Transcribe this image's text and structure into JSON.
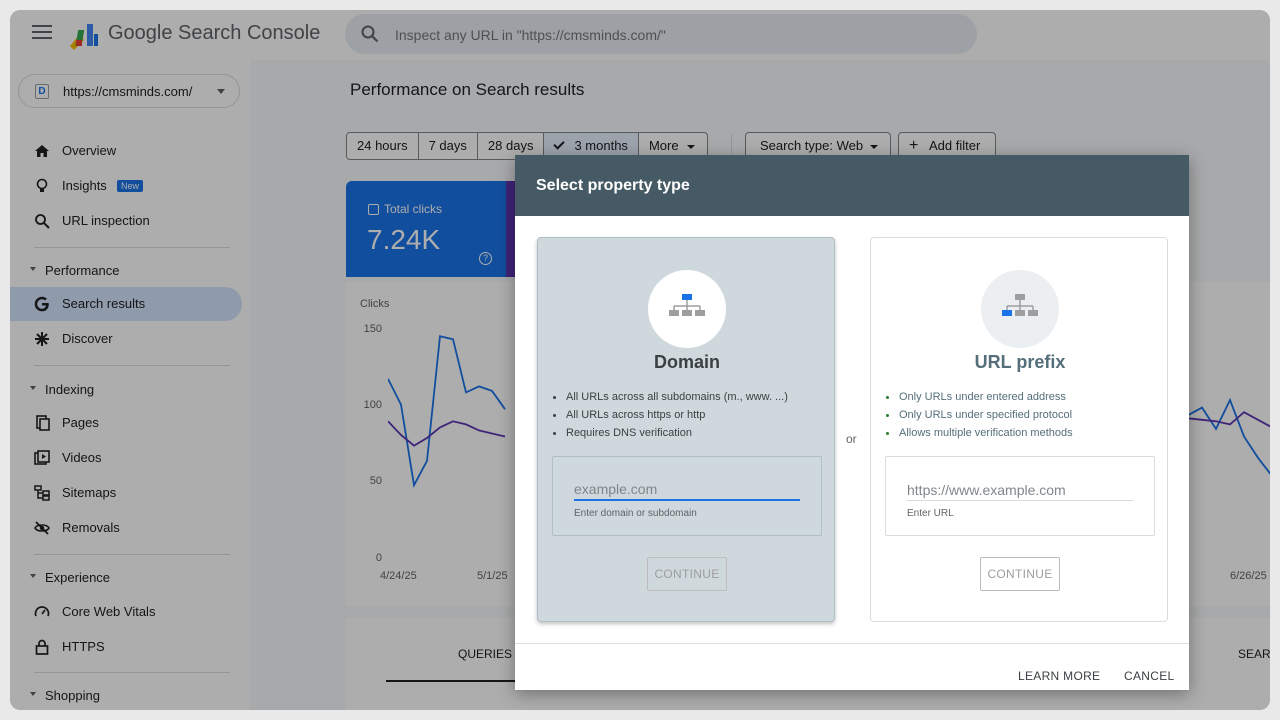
{
  "app": {
    "brand": "Google Search Console",
    "search_placeholder": "Inspect any URL in \"https://cmsminds.com/\""
  },
  "sidebar": {
    "property": {
      "badge": "D",
      "label": "https://cmsminds.com/"
    },
    "top_items": [
      {
        "label": "Overview",
        "icon": "home-icon"
      },
      {
        "label": "Insights",
        "icon": "lightbulb-icon",
        "badge": "New"
      },
      {
        "label": "URL inspection",
        "icon": "search-icon"
      }
    ],
    "sections": [
      {
        "label": "Performance",
        "items": [
          {
            "label": "Search results",
            "icon": "google-g-icon",
            "active": true
          },
          {
            "label": "Discover",
            "icon": "asterisk-icon"
          }
        ]
      },
      {
        "label": "Indexing",
        "items": [
          {
            "label": "Pages",
            "icon": "pages-icon"
          },
          {
            "label": "Videos",
            "icon": "videos-icon"
          },
          {
            "label": "Sitemaps",
            "icon": "sitemaps-icon"
          },
          {
            "label": "Removals",
            "icon": "eye-off-icon"
          }
        ]
      },
      {
        "label": "Experience",
        "items": [
          {
            "label": "Core Web Vitals",
            "icon": "gauge-icon"
          },
          {
            "label": "HTTPS",
            "icon": "lock-icon"
          }
        ]
      },
      {
        "label": "Shopping",
        "items": []
      }
    ]
  },
  "main": {
    "title": "Performance on Search results",
    "date_chips": [
      "24 hours",
      "7 days",
      "28 days",
      "3 months",
      "More"
    ],
    "selected_chip": "3 months",
    "search_type": "Search type: Web",
    "add_filter": "Add filter",
    "metric": {
      "label": "Total clicks",
      "value": "7.24K",
      "help": "?"
    },
    "chart": {
      "ylabel": "Clicks",
      "yticks": [
        "150",
        "100",
        "50",
        "0"
      ],
      "xticks": [
        "4/24/25",
        "5/1/25",
        "6/26/25"
      ]
    },
    "tabs": {
      "queries": "QUERIES",
      "search_appearance": "SEAR"
    }
  },
  "chart_data": {
    "type": "line",
    "ylabel": "Clicks",
    "ylim": [
      0,
      150
    ],
    "xticks": [
      "4/24/25",
      "5/1/25",
      "6/26/25"
    ],
    "series": [
      {
        "values": [
          112,
          95,
          42,
          58,
          140,
          138,
          103,
          107,
          104,
          92
        ]
      },
      {
        "values": [
          84,
          75,
          68,
          73,
          80,
          84,
          82,
          78,
          76,
          74
        ]
      }
    ],
    "series_right": [
      {
        "values": [
          88,
          93,
          79,
          98,
          74,
          60,
          48
        ]
      },
      {
        "values": [
          86,
          85,
          84,
          82,
          90,
          85,
          80
        ]
      }
    ]
  },
  "dialog": {
    "title": "Select property type",
    "or_label": "or",
    "domain": {
      "title": "Domain",
      "bullets": [
        "All URLs across all subdomains (m., www. ...)",
        "All URLs across https or http",
        "Requires DNS verification"
      ],
      "placeholder": "example.com",
      "help": "Enter domain or subdomain",
      "continue": "CONTINUE"
    },
    "url_prefix": {
      "title": "URL prefix",
      "bullets": [
        "Only URLs under entered address",
        "Only URLs under specified protocol",
        "Allows multiple verification methods"
      ],
      "placeholder": "https://www.example.com",
      "help": "Enter URL",
      "continue": "CONTINUE"
    },
    "learn_more": "LEARN MORE",
    "cancel": "CANCEL"
  },
  "colors": {
    "accent": "#1a73e8",
    "dialog_header": "#455a64",
    "domain_card": "#cfd8dc",
    "series2": "#5e35b1"
  }
}
